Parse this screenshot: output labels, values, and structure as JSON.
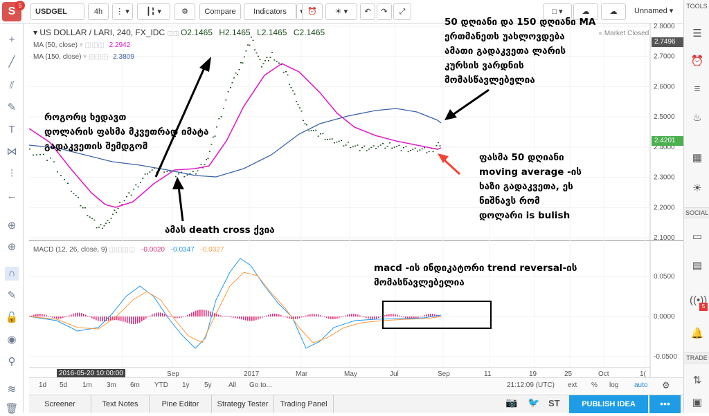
{
  "toolbar": {
    "avatar_letter": "S",
    "avatar_badge": "5",
    "symbol": "USDGEL",
    "interval": "4h",
    "compare": "Compare",
    "indicators": "Indicators",
    "layout_name": "Unnamed"
  },
  "legend": {
    "symbol_line": "US DOLLAR / LARI, 240, FX_IDC",
    "o": "O2.1465",
    "h": "H2.1465",
    "l": "L2.1465",
    "c": "C2.1465",
    "ma50_label": "MA (50, close)",
    "ma50_val": "2.2942",
    "ma150_label": "MA (150, close)",
    "ma150_val": "2.3809",
    "market": "Market Closed",
    "macd_label": "MACD (12, 26, close, 9)",
    "macd_v1": "-0.0020",
    "macd_v2": "-0.0347",
    "macd_v3": "-0.0327"
  },
  "price_axis": [
    "2.8000",
    "2.7000",
    "2.6000",
    "2.5000",
    "2.4000",
    "2.3000",
    "2.2000",
    "2.1000"
  ],
  "price_tags": {
    "last": "2.7496",
    "ma": "2.4201"
  },
  "macd_axis": [
    "0.0500",
    "0.0000",
    "-0.0500"
  ],
  "time_axis": [
    "Jul",
    "Sep",
    "2017",
    "Mar",
    "May",
    "Jul",
    "Sep",
    "11",
    "19",
    "25",
    "Oct",
    "1("
  ],
  "crosshair_date": "2016-05-20 10:00:00",
  "bottom_bar": {
    "ranges": [
      "1d",
      "5d",
      "1m",
      "3m",
      "6m",
      "YTD",
      "1y",
      "5y",
      "All",
      "Go to..."
    ],
    "clock": "21:12:09 (UTC)",
    "ext": "ext",
    "pct": "%",
    "log": "log",
    "auto": "auto"
  },
  "panels": [
    "Screener",
    "Text Notes",
    "Pine Editor",
    "Strategy Tester",
    "Trading Panel"
  ],
  "publish": "PUBLISH IDEA",
  "right_sections": {
    "tools": "TOOLS",
    "social": "SOCIAL",
    "trade": "TRADE",
    "badge": "5"
  },
  "annotations": {
    "a1": "50 დღიანი და 150 დღიანი MA",
    "a2": "ერთმანეთს უახლოვდება",
    "a3": "ამათი გადაკვეთა ლარის",
    "a4": "კურსის ვარდნის",
    "a5": "მომასწავლებელია",
    "b1": "როგორც ხედავთ",
    "b2": "დოლარის ფასმა მკვეთრად იმატა",
    "b3": "გადაკვეთის შემდგომ",
    "c1": "ამას death cross ქვია",
    "d1": "ფასმა 50 დღიანი",
    "d2": "moving average -ის",
    "d3": "ხაზი გადაკვეთა, ეს",
    "d4": "ნიშნავს რომ",
    "d5": "დოლარი is bulish",
    "e1": "macd -ის ინდიკატორი trend reversal-ის",
    "e2": "მომასწავლებელია"
  },
  "colors": {
    "ma50": "#e020c8",
    "ma150": "#3a63a8",
    "macd": "#2196f3",
    "signal": "#ff9a3c",
    "hist": "#e0307a",
    "price": "#1b4d1b",
    "accent": "#1e88e5",
    "arrow_red": "#f44336"
  }
}
